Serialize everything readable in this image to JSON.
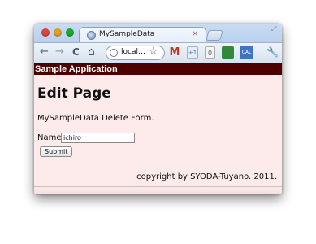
{
  "browser": {
    "tab": {
      "title": "MySampleData",
      "close_glyph": "×"
    },
    "address": {
      "value": "local…"
    },
    "nav": {
      "back_glyph": "←",
      "forward_glyph": "→",
      "reload_glyph": "C",
      "home_glyph": "⌂",
      "star_glyph": "☆",
      "wrench_glyph": "🔧"
    },
    "extensions": {
      "gmail": "M",
      "plus": "+1",
      "counter": "0",
      "calendar": "CAL"
    }
  },
  "app": {
    "banner": "Sample Application",
    "title": "Edit Page",
    "description": "MySampleData Delete Form.",
    "form": {
      "name_label": "Name",
      "name_value": "ichiro",
      "submit_label": "Submit"
    },
    "footer": "copyright by SYODA-Tuyano. 2011."
  },
  "colors": {
    "banner_bg": "#4d0000",
    "page_bg": "#fdeaea"
  }
}
